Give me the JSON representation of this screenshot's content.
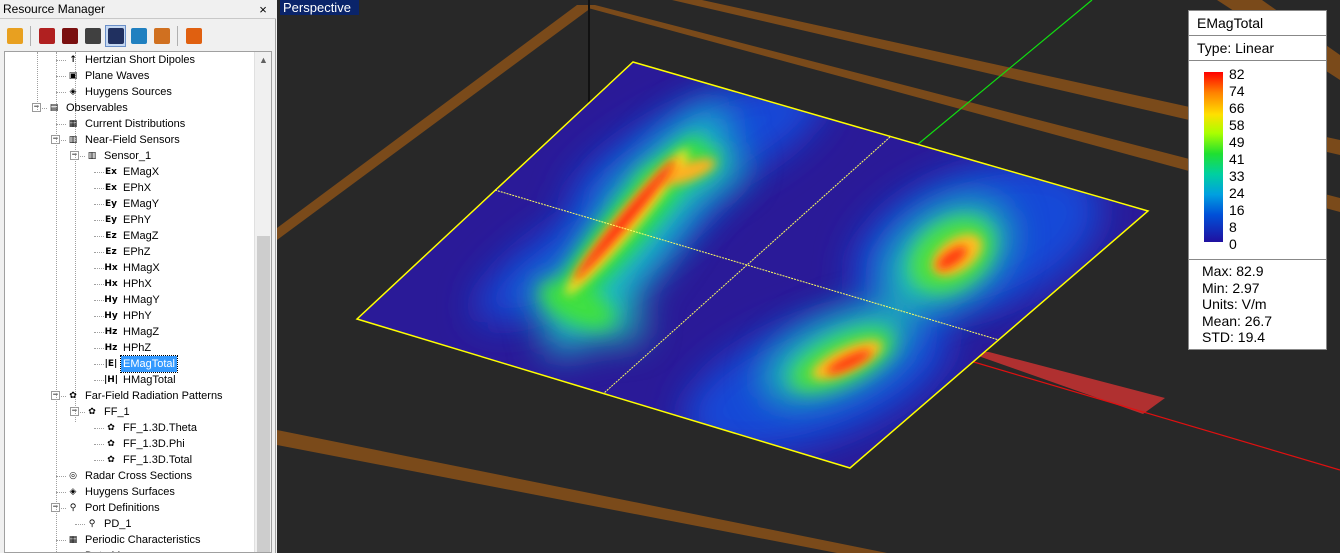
{
  "resource_manager": {
    "title": "Resource Manager",
    "close_glyph": "×",
    "toolbar": [
      {
        "icon": "geometry-icon",
        "color": "#e8a020",
        "active": false
      },
      {
        "icon": "material-icon",
        "color": "#b02020",
        "active": false
      },
      {
        "icon": "waveform-icon",
        "color": "#7a1010",
        "active": false
      },
      {
        "icon": "sensor-icon",
        "color": "#404040",
        "active": false
      },
      {
        "icon": "mesh-icon",
        "color": "#203060",
        "active": true
      },
      {
        "icon": "antenna-icon",
        "color": "#2080c0",
        "active": false
      },
      {
        "icon": "circuit-icon",
        "color": "#d07020",
        "active": false
      },
      {
        "icon": "script-icon",
        "color": "#e06010",
        "active": false
      }
    ],
    "tree": [
      {
        "label": "Hertzian Short Dipoles",
        "icon": "dipole-icon",
        "glyph": "↑",
        "level": 3
      },
      {
        "label": "Plane Waves",
        "icon": "plane-wave-icon",
        "glyph": "▣",
        "level": 3
      },
      {
        "label": "Huygens Sources",
        "icon": "huygens-source-icon",
        "glyph": "◈",
        "level": 3
      },
      {
        "label": "Observables",
        "icon": "observables-icon",
        "glyph": "▤",
        "level": 2,
        "expander": "−"
      },
      {
        "label": "Current Distributions",
        "icon": "current-distribution-icon",
        "glyph": "▦",
        "level": 3
      },
      {
        "label": "Near-Field Sensors",
        "icon": "near-field-sensor-icon",
        "glyph": "▥",
        "level": 3,
        "expander": "−"
      },
      {
        "label": "Sensor_1",
        "icon": "sensor-icon",
        "glyph": "▥",
        "level": 4,
        "expander": "−"
      },
      {
        "label": "EMagX",
        "icon": "emagx-icon",
        "glyph": "Ex",
        "level": 5
      },
      {
        "label": "EPhX",
        "icon": "ephx-icon",
        "glyph": "Ex",
        "level": 5
      },
      {
        "label": "EMagY",
        "icon": "emagy-icon",
        "glyph": "Ey",
        "level": 5
      },
      {
        "label": "EPhY",
        "icon": "ephy-icon",
        "glyph": "Ey",
        "level": 5
      },
      {
        "label": "EMagZ",
        "icon": "emagz-icon",
        "glyph": "Ez",
        "level": 5
      },
      {
        "label": "EPhZ",
        "icon": "ephz-icon",
        "glyph": "Ez",
        "level": 5
      },
      {
        "label": "HMagX",
        "icon": "hmagx-icon",
        "glyph": "Hx",
        "level": 5
      },
      {
        "label": "HPhX",
        "icon": "hphx-icon",
        "glyph": "Hx",
        "level": 5
      },
      {
        "label": "HMagY",
        "icon": "hmagy-icon",
        "glyph": "Hy",
        "level": 5
      },
      {
        "label": "HPhY",
        "icon": "hphy-icon",
        "glyph": "Hy",
        "level": 5
      },
      {
        "label": "HMagZ",
        "icon": "hmagz-icon",
        "glyph": "Hz",
        "level": 5
      },
      {
        "label": "HPhZ",
        "icon": "hphz-icon",
        "glyph": "Hz",
        "level": 5
      },
      {
        "label": "EMagTotal",
        "icon": "emagtotal-icon",
        "glyph": "|E|",
        "level": 5,
        "selected": true
      },
      {
        "label": "HMagTotal",
        "icon": "hmagtotal-icon",
        "glyph": "|H|",
        "level": 5
      },
      {
        "label": "Far-Field Radiation Patterns",
        "icon": "far-field-icon",
        "glyph": "✿",
        "level": 3,
        "expander": "−"
      },
      {
        "label": "FF_1",
        "icon": "far-field-set-icon",
        "glyph": "✿",
        "level": 4,
        "expander": "−"
      },
      {
        "label": "FF_1.3D.Theta",
        "icon": "far-field-theta-icon",
        "glyph": "✿",
        "level": 5
      },
      {
        "label": "FF_1.3D.Phi",
        "icon": "far-field-phi-icon",
        "glyph": "✿",
        "level": 5
      },
      {
        "label": "FF_1.3D.Total",
        "icon": "far-field-total-icon",
        "glyph": "✿",
        "level": 5
      },
      {
        "label": "Radar Cross Sections",
        "icon": "radar-cross-section-icon",
        "glyph": "◎",
        "level": 3
      },
      {
        "label": "Huygens Surfaces",
        "icon": "huygens-surface-icon",
        "glyph": "◈",
        "level": 3
      },
      {
        "label": "Port Definitions",
        "icon": "port-definition-icon",
        "glyph": "⚲",
        "level": 3,
        "expander": "−"
      },
      {
        "label": "PD_1",
        "icon": "port-icon",
        "glyph": "⚲",
        "level": 4
      },
      {
        "label": "Periodic Characteristics",
        "icon": "periodic-characteristics-icon",
        "glyph": "▦",
        "level": 3
      },
      {
        "label": "Data M",
        "icon": "data-icon",
        "glyph": "▦",
        "level": 3
      }
    ]
  },
  "viewport": {
    "label": "Perspective",
    "background": "#282828",
    "colors": {
      "grid": "#7a4a1a",
      "outline": "#ffff00",
      "axis_x": "#e01010",
      "axis_y": "#10e010",
      "port": "#b03030"
    }
  },
  "legend": {
    "title": "EMagTotal",
    "type": "Type: Linear",
    "ticks": [
      "82",
      "74",
      "66",
      "58",
      "49",
      "41",
      "33",
      "24",
      "16",
      "8",
      "0"
    ],
    "stats": {
      "max": "Max: 82.9",
      "min": "Min: 2.97",
      "units": "Units: V/m",
      "mean": "Mean: 26.7",
      "std": "STD: 19.4"
    }
  }
}
